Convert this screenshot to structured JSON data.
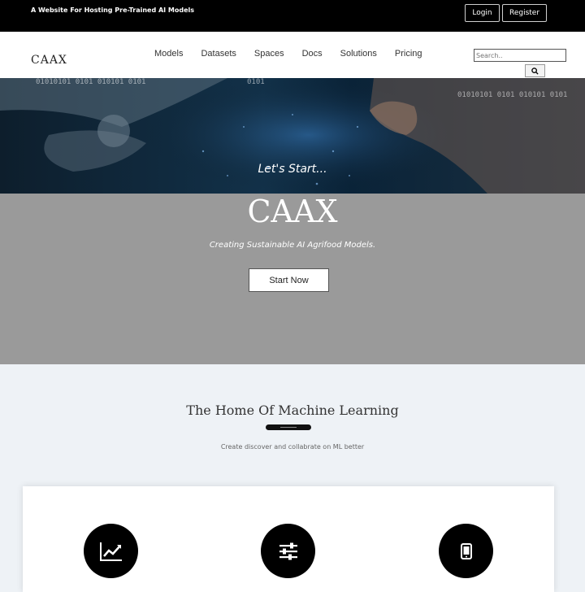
{
  "topbar": {
    "tagline": "A Website For Hosting Pre-Trained AI Models",
    "login": "Login",
    "register": "Register"
  },
  "nav": {
    "logo": "CAAX",
    "links": [
      "Models",
      "Datasets",
      "Spaces",
      "Docs",
      "Solutions",
      "Pricing"
    ],
    "search_placeholder": "Search.."
  },
  "hero": {
    "binary": [
      "01010101 0101 010101 0101",
      "0101",
      "01010101 0101 010101 0101"
    ],
    "lets_start": "Let's Start...",
    "brand": "CAAX",
    "slogan": "Creating Sustainable AI Agrifood Models.",
    "start_button": "Start Now"
  },
  "section": {
    "title": "The Home Of Machine Learning",
    "subtitle": "Create discover and collabrate on ML better"
  },
  "features": {
    "icons": [
      "chart-icon",
      "sliders-icon",
      "mobile-icon"
    ]
  },
  "colors": {
    "topbar": "#000000",
    "hero_gray": "#9a9a9a",
    "background": "#eef2f6"
  }
}
